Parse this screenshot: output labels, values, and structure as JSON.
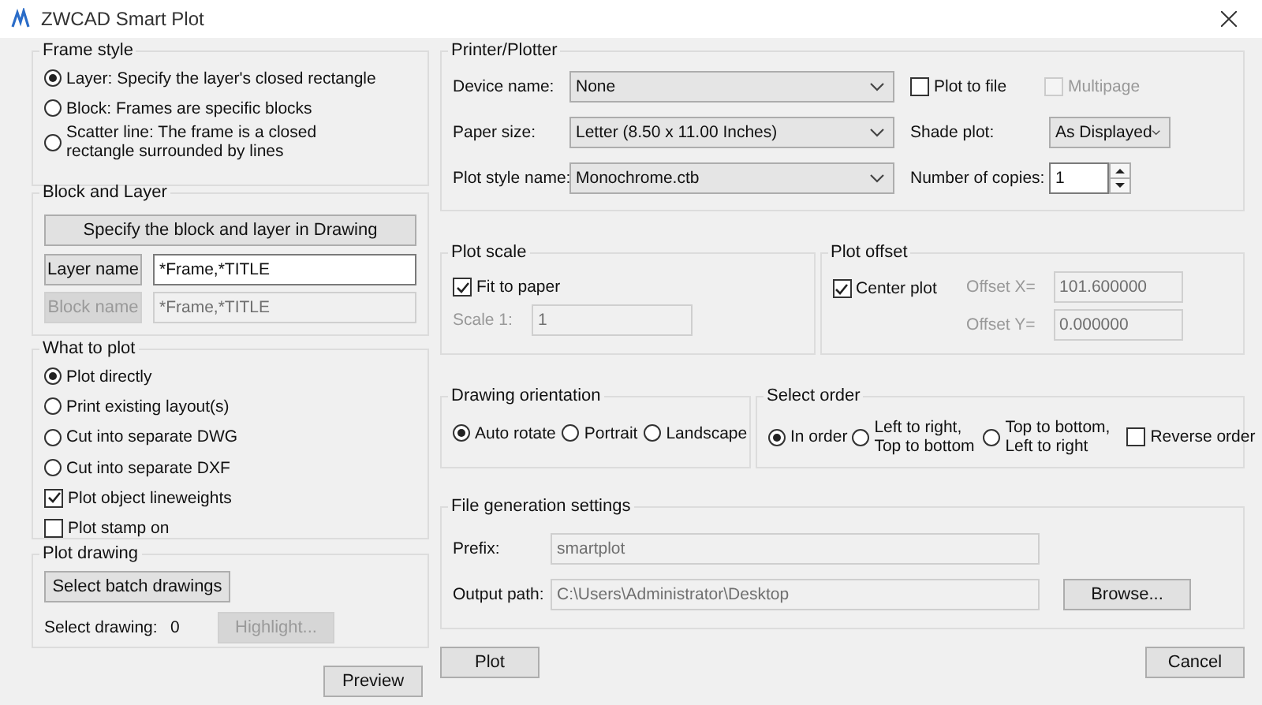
{
  "window": {
    "title": "ZWCAD Smart Plot"
  },
  "frame_style": {
    "title": "Frame style",
    "options": [
      {
        "label": "Layer: Specify the layer's closed rectangle",
        "selected": true
      },
      {
        "label": "Block: Frames are specific blocks",
        "selected": false
      },
      {
        "label": "Scatter line: The frame is a closed rectangle surrounded by lines",
        "selected": false
      }
    ]
  },
  "block_and_layer": {
    "title": "Block and Layer",
    "specify_button": "Specify the block and layer in Drawing",
    "rows": [
      {
        "button": "Layer name",
        "value": "*Frame,*TITLE",
        "disabled": false
      },
      {
        "button": "Block name",
        "value": "*Frame,*TITLE",
        "disabled": true
      }
    ]
  },
  "what_to_plot": {
    "title": "What to plot",
    "items": [
      {
        "kind": "radio",
        "label": "Plot directly",
        "selected": true
      },
      {
        "kind": "radio",
        "label": "Print existing layout(s)",
        "selected": false
      },
      {
        "kind": "radio",
        "label": "Cut into separate DWG",
        "selected": false
      },
      {
        "kind": "radio",
        "label": "Cut into separate DXF",
        "selected": false
      },
      {
        "kind": "checkbox",
        "label": "Plot object lineweights",
        "checked": true
      },
      {
        "kind": "checkbox",
        "label": "Plot stamp on",
        "checked": false
      }
    ]
  },
  "plot_drawing": {
    "title": "Plot drawing",
    "select_button": "Select batch drawings",
    "select_label": "Select drawing:",
    "count": "0",
    "highlight_button": {
      "label": "Highlight...",
      "disabled": true
    }
  },
  "printer": {
    "title": "Printer/Plotter",
    "dropdowns": [
      {
        "label": "Device name:",
        "value": "None"
      },
      {
        "label": "Paper size:",
        "value": "Letter (8.50 x 11.00 Inches)"
      },
      {
        "label": "Plot style name:",
        "value": "Monochrome.ctb"
      }
    ],
    "plot_to_file": {
      "label": "Plot to file",
      "checked": false,
      "disabled": false
    },
    "multipage": {
      "label": "Multipage",
      "checked": false,
      "disabled": true
    },
    "shade": {
      "label": "Shade plot:",
      "value": "As Displayed"
    },
    "copies": {
      "label": "Number of copies:",
      "value": "1"
    }
  },
  "plot_scale": {
    "title": "Plot scale",
    "fit": {
      "label": "Fit to paper",
      "checked": true,
      "disabled": false
    },
    "scale": {
      "label": "Scale 1:",
      "value": "1",
      "disabled": true
    }
  },
  "plot_offset": {
    "title": "Plot offset",
    "center": {
      "label": "Center plot",
      "checked": true,
      "disabled": false
    },
    "fields": [
      {
        "label": "Offset X=",
        "value": "101.600000",
        "disabled": true
      },
      {
        "label": "Offset Y=",
        "value": "0.000000",
        "disabled": true
      }
    ]
  },
  "orientation": {
    "title": "Drawing orientation",
    "options": [
      {
        "label": "Auto rotate",
        "selected": true
      },
      {
        "label": "Portrait",
        "selected": false
      },
      {
        "label": "Landscape",
        "selected": false
      }
    ]
  },
  "select_order": {
    "title": "Select order",
    "options": [
      {
        "label": "In order",
        "selected": true
      },
      {
        "label": "Left to right, Top to bottom",
        "selected": false
      },
      {
        "label": "Top to bottom, Left to right",
        "selected": false
      }
    ],
    "reverse": {
      "label": "Reverse order",
      "checked": false,
      "disabled": false
    }
  },
  "file_generation": {
    "title": "File generation settings",
    "fields": [
      {
        "label": "Prefix:",
        "value": "smartplot",
        "disabled": true
      },
      {
        "label": "Output path:",
        "value": "C:\\Users\\Administrator\\Desktop",
        "disabled": true
      }
    ],
    "browse_button": "Browse..."
  },
  "buttons": {
    "preview": "Preview",
    "plot": "Plot",
    "cancel": "Cancel"
  }
}
